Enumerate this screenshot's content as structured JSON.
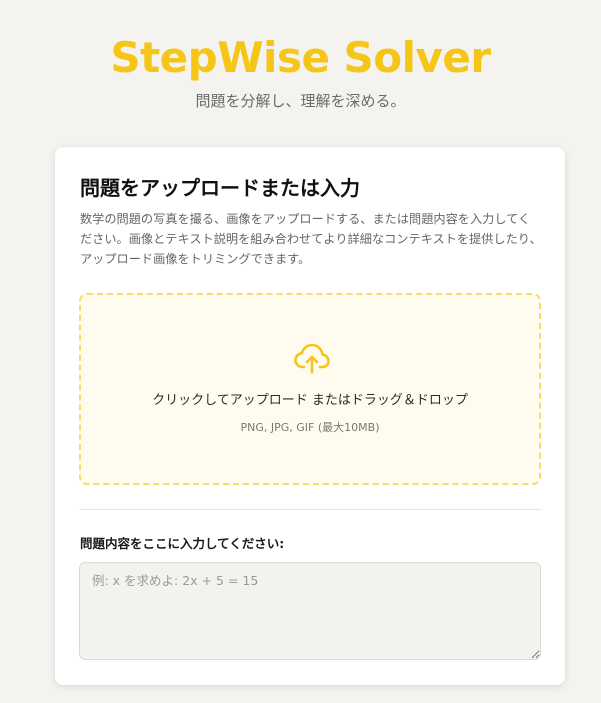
{
  "header": {
    "title": "StepWise Solver",
    "subtitle": "問題を分解し、理解を深める。"
  },
  "card": {
    "title": "問題をアップロードまたは入力",
    "description": "数学の問題の写真を撮る、画像をアップロードする、または問題内容を入力してください。画像とテキスト説明を組み合わせてより詳細なコンテキストを提供したり、アップロード画像をトリミングできます。"
  },
  "dropzone": {
    "icon": "cloud-upload-icon",
    "label": "クリックしてアップロード またはドラッグ＆ドロップ",
    "hint": "PNG, JPG, GIF (最大10MB)"
  },
  "problem_field": {
    "label": "問題内容をここに入力してください:",
    "value": "",
    "placeholder": "例: x を求めよ: 2x + 5 = 15"
  },
  "colors": {
    "accent": "#f5c518",
    "dropzone_border": "#f5dc6b",
    "dropzone_background": "#fffcef",
    "page_background": "#f4f3ef"
  }
}
